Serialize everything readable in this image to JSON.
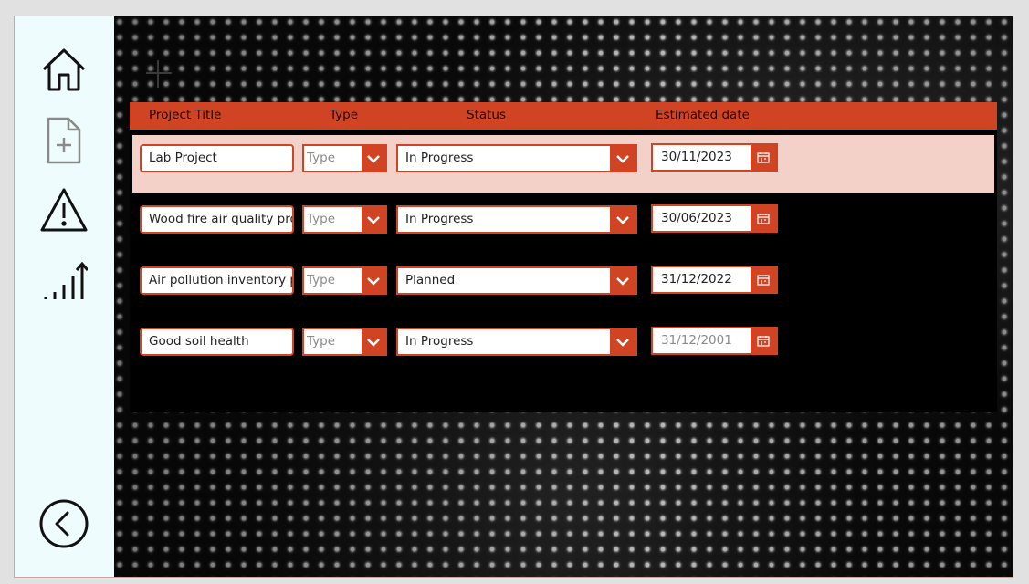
{
  "sidebar": {
    "items": [
      {
        "icon": "home-icon",
        "label": "Home"
      },
      {
        "icon": "new-document-icon",
        "label": "New"
      },
      {
        "icon": "warning-icon",
        "label": "Issues"
      },
      {
        "icon": "chart-icon",
        "label": "Reports"
      }
    ],
    "back_icon": "back-icon"
  },
  "colors": {
    "accent": "#d14423",
    "selected_row": "#f3d1c8",
    "sidebar_bg": "#eefcfd"
  },
  "gallery": {
    "headers": {
      "title": "Project Title",
      "type": "Type",
      "status": "Status",
      "date": "Estimated date"
    },
    "rows": [
      {
        "title": "Lab Project",
        "type": "Type",
        "status": "In Progress",
        "date": "30/11/2023",
        "selected": true
      },
      {
        "title": "Wood fire air quality project",
        "type": "Type",
        "status": "In Progress",
        "date": "30/06/2023"
      },
      {
        "title": "Air pollution inventory project",
        "type": "Type",
        "status": "Planned",
        "date": "31/12/2022"
      },
      {
        "title": "Good soil health",
        "type": "Type",
        "status": "In Progress",
        "date": "31/12/2001",
        "date_muted": true
      }
    ]
  }
}
